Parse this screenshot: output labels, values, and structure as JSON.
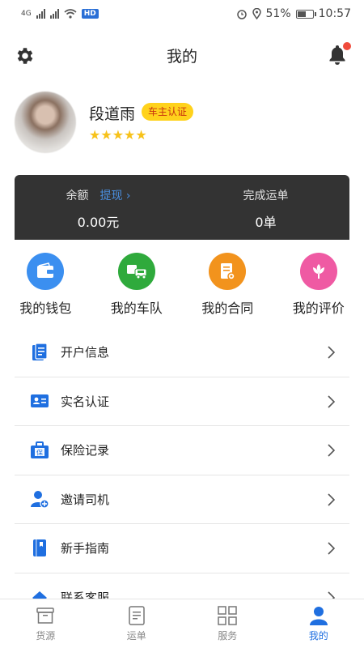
{
  "status_bar": {
    "network_label": "4G",
    "hd_label": "HD",
    "battery_text": "51%",
    "time": "10:57"
  },
  "header": {
    "title": "我的"
  },
  "profile": {
    "name": "段道雨",
    "badge": "车主认证",
    "rating": 5,
    "stars": "★★★★★"
  },
  "stats": {
    "balance_label": "余额",
    "withdraw_label": "提现 ›",
    "balance_value": "0.00元",
    "orders_label": "完成运单",
    "orders_value": "0单"
  },
  "quick_actions": [
    {
      "label": "我的钱包",
      "icon": "wallet-icon",
      "color": "#3b8ff0"
    },
    {
      "label": "我的车队",
      "icon": "truck-icon",
      "color": "#2faa3c"
    },
    {
      "label": "我的合同",
      "icon": "contract-icon",
      "color": "#f2931d"
    },
    {
      "label": "我的评价",
      "icon": "flower-icon",
      "color": "#ef5aa3"
    }
  ],
  "menu": [
    {
      "label": "开户信息",
      "icon": "document-icon"
    },
    {
      "label": "实名认证",
      "icon": "id-card-icon"
    },
    {
      "label": "保险记录",
      "icon": "insurance-icon"
    },
    {
      "label": "邀请司机",
      "icon": "add-user-icon"
    },
    {
      "label": "新手指南",
      "icon": "book-icon"
    },
    {
      "label": "联系客服",
      "icon": "service-icon"
    }
  ],
  "tabs": [
    {
      "label": "货源",
      "icon": "cargo-icon",
      "active": false
    },
    {
      "label": "运单",
      "icon": "waybill-icon",
      "active": false
    },
    {
      "label": "服务",
      "icon": "grid-icon",
      "active": false
    },
    {
      "label": "我的",
      "icon": "profile-icon",
      "active": true
    }
  ],
  "colors": {
    "accent": "#1f6fe0",
    "card_bg": "#333333",
    "badge_bg": "#ffd21c",
    "star": "#f7c21a"
  }
}
